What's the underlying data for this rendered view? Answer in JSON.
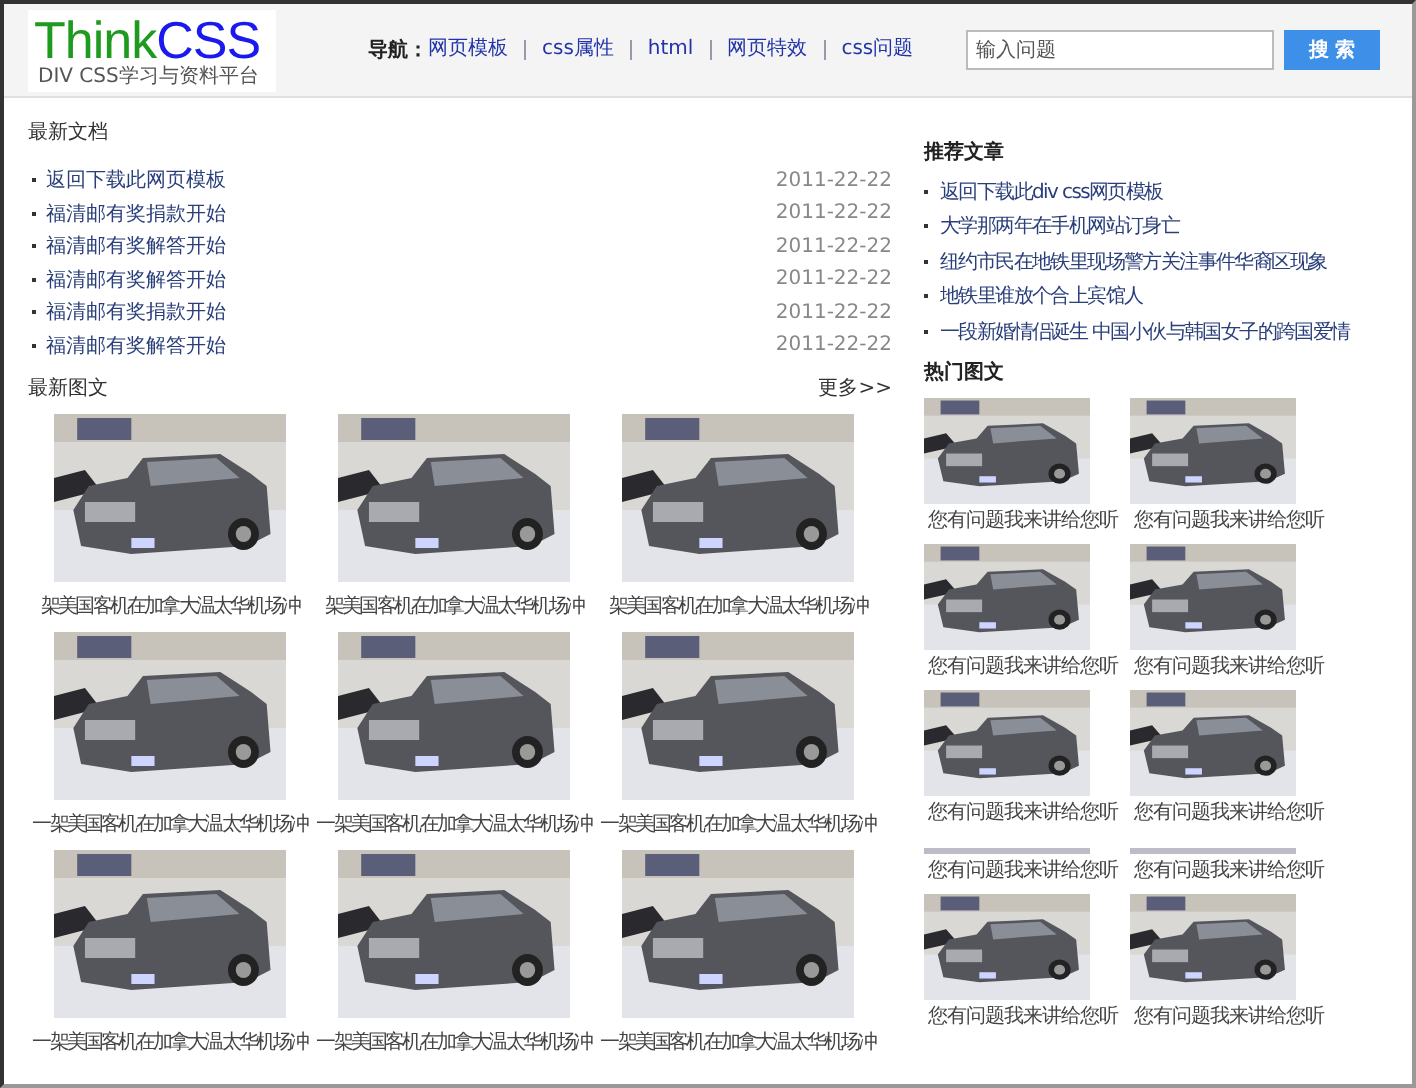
{
  "header": {
    "logo": {
      "text_1": "Think",
      "text_2": "CSS"
    },
    "slogan": "DIV CSS学习与资料平台",
    "nav_label": "导航：",
    "nav": [
      "网页模板",
      "css属性",
      "html",
      "网页特效",
      "css问题"
    ],
    "search": {
      "placeholder": "输入问题"
    },
    "search_button": "搜 索"
  },
  "latest_docs": {
    "title": "最新文档",
    "items": [
      {
        "title": "返回下载此网页模板",
        "date": "2011-22-22"
      },
      {
        "title": "福清邮有奖捐款开始",
        "date": "2011-22-22"
      },
      {
        "title": "福清邮有奖解答开始",
        "date": "2011-22-22"
      },
      {
        "title": "福清邮有奖解答开始",
        "date": "2011-22-22"
      },
      {
        "title": "福清邮有奖捐款开始",
        "date": "2011-22-22"
      },
      {
        "title": "福清邮有奖解答开始",
        "date": "2011-22-22"
      }
    ]
  },
  "latest_gallery": {
    "title": "最新图文",
    "more": "更多>>",
    "items": [
      {
        "caption": "架美国客机在加拿大温太华机场冲"
      },
      {
        "caption": "架美国客机在加拿大温太华机场冲"
      },
      {
        "caption": "架美国客机在加拿大温太华机场冲"
      },
      {
        "caption": "一架美国客机在加拿大温太华机场冲"
      },
      {
        "caption": "一架美国客机在加拿大温太华机场冲"
      },
      {
        "caption": "一架美国客机在加拿大温太华机场冲"
      },
      {
        "caption": "一架美国客机在加拿大温太华机场冲"
      },
      {
        "caption": "一架美国客机在加拿大温太华机场冲"
      },
      {
        "caption": "一架美国客机在加拿大温太华机场冲"
      }
    ]
  },
  "recommended": {
    "title": "推荐文章",
    "items": [
      "返回下载此div css网页模板",
      "大学那两年在手机网站订身亡",
      "纽约市民在地铁里现场警方关注事件华裔区现象",
      "地铁里谁放个合上宾馆人",
      "一段新婚情侣诞生 中国小伙与韩国女子的跨国爱情"
    ]
  },
  "hot_gallery": {
    "title": "热门图文",
    "items": [
      {
        "kind": "photo",
        "caption": "您有问题我来讲给您听"
      },
      {
        "kind": "photo",
        "caption": "您有问题我来讲给您听"
      },
      {
        "kind": "photo",
        "caption": "您有问题我来讲给您听"
      },
      {
        "kind": "photo",
        "caption": "您有问题我来讲给您听"
      },
      {
        "kind": "photo",
        "caption": "您有问题我来讲给您听"
      },
      {
        "kind": "photo",
        "caption": "您有问题我来讲给您听"
      },
      {
        "kind": "broken",
        "caption": "您有问题我来讲给您听"
      },
      {
        "kind": "broken",
        "caption": "您有问题我来讲给您听"
      },
      {
        "kind": "photo",
        "caption": "您有问题我来讲给您听"
      },
      {
        "kind": "photo",
        "caption": "您有问题我来讲给您听"
      }
    ]
  }
}
